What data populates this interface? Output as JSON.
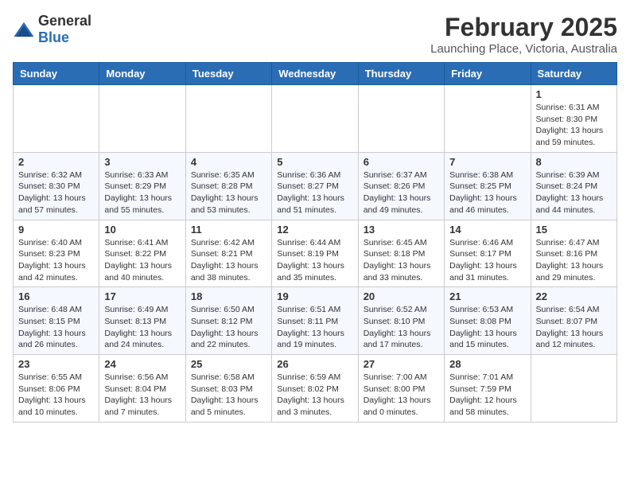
{
  "logo": {
    "general": "General",
    "blue": "Blue"
  },
  "title": "February 2025",
  "subtitle": "Launching Place, Victoria, Australia",
  "weekdays": [
    "Sunday",
    "Monday",
    "Tuesday",
    "Wednesday",
    "Thursday",
    "Friday",
    "Saturday"
  ],
  "weeks": [
    [
      {
        "day": "",
        "info": ""
      },
      {
        "day": "",
        "info": ""
      },
      {
        "day": "",
        "info": ""
      },
      {
        "day": "",
        "info": ""
      },
      {
        "day": "",
        "info": ""
      },
      {
        "day": "",
        "info": ""
      },
      {
        "day": "1",
        "info": "Sunrise: 6:31 AM\nSunset: 8:30 PM\nDaylight: 13 hours and 59 minutes."
      }
    ],
    [
      {
        "day": "2",
        "info": "Sunrise: 6:32 AM\nSunset: 8:30 PM\nDaylight: 13 hours and 57 minutes."
      },
      {
        "day": "3",
        "info": "Sunrise: 6:33 AM\nSunset: 8:29 PM\nDaylight: 13 hours and 55 minutes."
      },
      {
        "day": "4",
        "info": "Sunrise: 6:35 AM\nSunset: 8:28 PM\nDaylight: 13 hours and 53 minutes."
      },
      {
        "day": "5",
        "info": "Sunrise: 6:36 AM\nSunset: 8:27 PM\nDaylight: 13 hours and 51 minutes."
      },
      {
        "day": "6",
        "info": "Sunrise: 6:37 AM\nSunset: 8:26 PM\nDaylight: 13 hours and 49 minutes."
      },
      {
        "day": "7",
        "info": "Sunrise: 6:38 AM\nSunset: 8:25 PM\nDaylight: 13 hours and 46 minutes."
      },
      {
        "day": "8",
        "info": "Sunrise: 6:39 AM\nSunset: 8:24 PM\nDaylight: 13 hours and 44 minutes."
      }
    ],
    [
      {
        "day": "9",
        "info": "Sunrise: 6:40 AM\nSunset: 8:23 PM\nDaylight: 13 hours and 42 minutes."
      },
      {
        "day": "10",
        "info": "Sunrise: 6:41 AM\nSunset: 8:22 PM\nDaylight: 13 hours and 40 minutes."
      },
      {
        "day": "11",
        "info": "Sunrise: 6:42 AM\nSunset: 8:21 PM\nDaylight: 13 hours and 38 minutes."
      },
      {
        "day": "12",
        "info": "Sunrise: 6:44 AM\nSunset: 8:19 PM\nDaylight: 13 hours and 35 minutes."
      },
      {
        "day": "13",
        "info": "Sunrise: 6:45 AM\nSunset: 8:18 PM\nDaylight: 13 hours and 33 minutes."
      },
      {
        "day": "14",
        "info": "Sunrise: 6:46 AM\nSunset: 8:17 PM\nDaylight: 13 hours and 31 minutes."
      },
      {
        "day": "15",
        "info": "Sunrise: 6:47 AM\nSunset: 8:16 PM\nDaylight: 13 hours and 29 minutes."
      }
    ],
    [
      {
        "day": "16",
        "info": "Sunrise: 6:48 AM\nSunset: 8:15 PM\nDaylight: 13 hours and 26 minutes."
      },
      {
        "day": "17",
        "info": "Sunrise: 6:49 AM\nSunset: 8:13 PM\nDaylight: 13 hours and 24 minutes."
      },
      {
        "day": "18",
        "info": "Sunrise: 6:50 AM\nSunset: 8:12 PM\nDaylight: 13 hours and 22 minutes."
      },
      {
        "day": "19",
        "info": "Sunrise: 6:51 AM\nSunset: 8:11 PM\nDaylight: 13 hours and 19 minutes."
      },
      {
        "day": "20",
        "info": "Sunrise: 6:52 AM\nSunset: 8:10 PM\nDaylight: 13 hours and 17 minutes."
      },
      {
        "day": "21",
        "info": "Sunrise: 6:53 AM\nSunset: 8:08 PM\nDaylight: 13 hours and 15 minutes."
      },
      {
        "day": "22",
        "info": "Sunrise: 6:54 AM\nSunset: 8:07 PM\nDaylight: 13 hours and 12 minutes."
      }
    ],
    [
      {
        "day": "23",
        "info": "Sunrise: 6:55 AM\nSunset: 8:06 PM\nDaylight: 13 hours and 10 minutes."
      },
      {
        "day": "24",
        "info": "Sunrise: 6:56 AM\nSunset: 8:04 PM\nDaylight: 13 hours and 7 minutes."
      },
      {
        "day": "25",
        "info": "Sunrise: 6:58 AM\nSunset: 8:03 PM\nDaylight: 13 hours and 5 minutes."
      },
      {
        "day": "26",
        "info": "Sunrise: 6:59 AM\nSunset: 8:02 PM\nDaylight: 13 hours and 3 minutes."
      },
      {
        "day": "27",
        "info": "Sunrise: 7:00 AM\nSunset: 8:00 PM\nDaylight: 13 hours and 0 minutes."
      },
      {
        "day": "28",
        "info": "Sunrise: 7:01 AM\nSunset: 7:59 PM\nDaylight: 12 hours and 58 minutes."
      },
      {
        "day": "",
        "info": ""
      }
    ]
  ]
}
